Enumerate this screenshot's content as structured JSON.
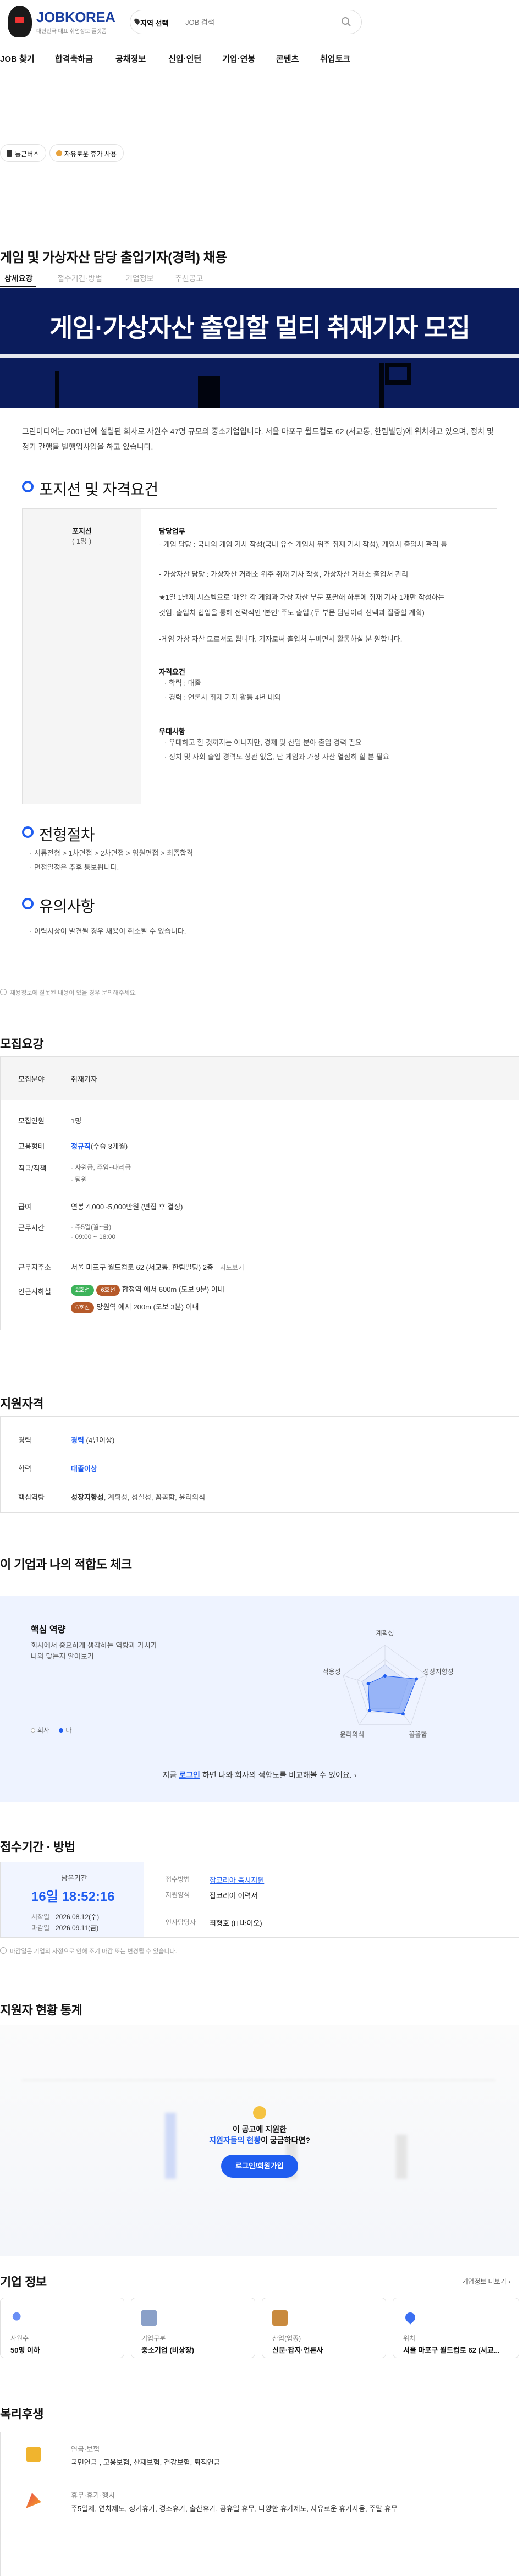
{
  "header": {
    "brand": "JOBKOREA",
    "tagline": "대한민국 대표 취업정보 플랫폼",
    "region_label": "지역 선택",
    "search_placeholder": "JOB 검색"
  },
  "nav": [
    "JOB 찾기",
    "합격축하금",
    "공채정보",
    "신입·인턴",
    "기업·연봉",
    "콘텐츠",
    "취업토크"
  ],
  "pills": [
    "통근버스",
    "자유로운 휴가 사용"
  ],
  "job": {
    "title": "게임 및 가상자산 담당 출입기자(경력) 채용"
  },
  "tabs": [
    "상세요강",
    "접수기간·방법",
    "기업정보",
    "추천공고"
  ],
  "banner": {
    "title": "게임·가상자산 출입할 멀티 취재기자 모집"
  },
  "intro": "그린미디어는 2001년에 설립된 회사로 사원수 47명 규모의 중소기업입니다. 서울 마포구 월드컵로 62 (서교동, 한림빌딩)에 위치하고 있으며, 정치 및 정기 간행물 발행업사업을 하고 있습니다.",
  "positions": {
    "heading": "포지션 및 자격요건",
    "left_label": "포지션",
    "left_count": "( 1명 )",
    "duty_head": "담당업무",
    "duty_lines": [
      "- 게임 담당 : 국내외 게임 기사 작성(국내 유수 게임사 위주 취재 기사 작성), 게임사 출입처 관리 등",
      "- 가상자산 담당 : 가상자산 거래소 위주 취재 기사 작성, 가상자산 거래소 출입처 관리"
    ],
    "note_lines": [
      "★1일 1발제 시스템으로 '매일' 각 게임과 가상 자산 부문 포괄해 하루에 취재 기사 1개만 작성하는",
      "것임. 출입처 협업을 통해 전략적인 '본인' 주도 출입.(두 부문 담당이라 선택과 집중할 계획)"
    ],
    "extra_line": "-게임 가상 자산 모르셔도 됩니다. 기자로써 출입처 누비면서 활동하실 분 원합니다.",
    "qual_head": "자격요건",
    "qual_lines": [
      "· 학력 : 대졸",
      "· 경력 : 언론사 취재 기자 활동 4년 내외"
    ],
    "pref_head": "우대사항",
    "pref_lines": [
      "· 우대하고 할 것까지는 아니지만, 경제 및 산업 분야 출입 경력 필요",
      "· 정치 및 사회 출입 경력도 상관 없음, 단 게임과 가상 자산 열심히 할 분 필요"
    ]
  },
  "process": {
    "heading": "전형절차",
    "steps": "· 서류전형 > 1차면접 > 2차면접 > 임원면접 > 최종합격",
    "note": "· 면접일정은 추후 통보됩니다."
  },
  "caution": {
    "heading": "유의사항",
    "text": "· 이력서상이 발견될 경우 채용이 취소될 수 있습니다."
  },
  "report_note": "채용정보에 잘못된 내용이 있을 경우 문의해주세요.",
  "summary": {
    "heading": "모집요강",
    "rows": [
      {
        "label": "모집분야",
        "value": "취재기자"
      },
      {
        "label": "모집인원",
        "value": "1명"
      },
      {
        "label": "고용형태",
        "value": "정규직",
        "extra": "(수습 3개월)"
      },
      {
        "label": "직급/직책",
        "lines": [
          "· 사원급, 주임~대리급",
          "· 팀원"
        ]
      },
      {
        "label": "급여",
        "value": "연봉 4,000~5,000만원 (면접 후 결정)"
      },
      {
        "label": "근무시간",
        "lines": [
          "· 주5일(월~금)",
          "· 09:00 ~ 18:00"
        ]
      },
      {
        "label": "근무지주소",
        "value": "서울 마포구 월드컵로 62 (서교동, 한림빌딩) 2층",
        "link": "지도보기"
      },
      {
        "label": "인근지하철",
        "lines": [
          "합정역 에서 600m (도보 9분) 이내",
          "망원역 에서 200m (도보 3분) 이내"
        ],
        "badges": [
          [
            "2호선",
            "6호선"
          ],
          [
            "6호선"
          ]
        ]
      }
    ]
  },
  "requirements": {
    "heading": "지원자격",
    "rows": [
      {
        "label": "경력",
        "value": "경력",
        "extra": " (4년이상)"
      },
      {
        "label": "학력",
        "value": "대졸이상"
      },
      {
        "label": "핵심역량",
        "value": "성장지향성",
        "extra": ", 계획성, 성실성, 꼼꼼함, 윤리의식"
      }
    ]
  },
  "fit": {
    "heading": "이 기업과 나의 적합도 체크",
    "box_title": "핵심 역량",
    "box_desc": [
      "회사에서 중요하게 생각하는 역량과 가치가",
      "나와 맞는지 알아보기"
    ],
    "legend": [
      "회사",
      "나"
    ],
    "axes": [
      "계획성",
      "성장지향성",
      "꼼꼼함",
      "윤리의식",
      "적응성"
    ],
    "cta_pre": "지금 ",
    "cta_link": "로그인",
    "cta_post": " 하면 나와 회사의 적합도를 비교해볼 수 있어요.",
    "company_values": [
      0.55,
      0.55,
      0.55,
      0.55,
      0.55
    ],
    "me_values": [
      0.3,
      0.75,
      0.7,
      0.6,
      0.4
    ]
  },
  "apply": {
    "heading": "접수기간 · 방법",
    "remain_label": "남은기간",
    "remain": "16일 18:52:16",
    "start_label": "시작일",
    "start": "2026.08.12(수)",
    "end_label": "마감일",
    "end": "2026.09.11(금)",
    "method_label": "접수방법",
    "method": "잡코리아 즉시지원",
    "form_label": "지원양식",
    "form": "잡코리아 이력서",
    "manager_label": "인사담당자",
    "manager": "최형호 (IT바이오)",
    "note": "마감일은 기업의 사정으로 인해 조기 마감 또는 변경될 수 있습니다."
  },
  "stats": {
    "heading": "지원자 현황 통계",
    "overlay_line1": "이 공고에 지원한",
    "overlay_hl": "지원자들의 현황",
    "overlay_line2": "이 궁금하다면?",
    "button": "로그인/회원가입"
  },
  "company": {
    "heading": "기업 정보",
    "more": "기업정보 더보기",
    "cards": [
      {
        "label": "사원수",
        "value": "50명 이하"
      },
      {
        "label": "기업구분",
        "value": "중소기업 (비상장)"
      },
      {
        "label": "산업(업종)",
        "value": "신문·잡지·언론사"
      },
      {
        "label": "위치",
        "value": "서울 마포구 월드컵로 62 (서교..."
      }
    ]
  },
  "welfare": {
    "heading": "복리후생",
    "items": [
      {
        "title": "연금·보험",
        "text": "국민연금 , 고용보험, 산재보험, 건강보험, 퇴직연금"
      },
      {
        "title": "휴무·휴가·행사",
        "text": "주5일제, 연차제도, 정기휴가, 경조휴가, 출산휴가, 공휴일 휴무, 다양한 휴가제도, 자유로운 휴가사용, 주말 휴무"
      }
    ]
  },
  "colors": {
    "accent": "#1f5df0",
    "banner": "#0b1c5c",
    "line2": "#3db35a",
    "line6": "#b65a2a"
  }
}
